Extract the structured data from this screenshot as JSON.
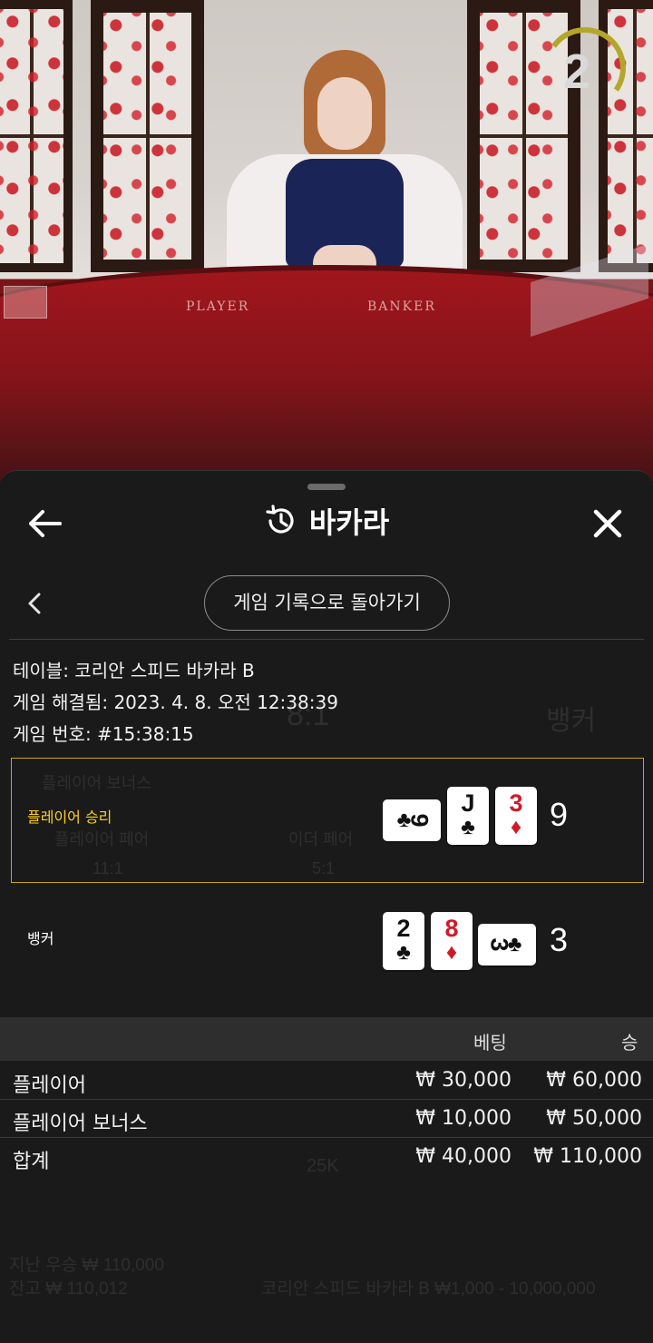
{
  "video": {
    "timer_value": "2",
    "felt_left": "PLAYER",
    "felt_right": "BANKER"
  },
  "header": {
    "title": "바카라"
  },
  "subnav": {
    "back_to_history_label": "게임 기록으로 돌아가기"
  },
  "info": {
    "table": "테이블: 코리안 스피드 바카라 B",
    "resolved": "게임 해결됨: 2023. 4. 8. 오전 12:38:39",
    "game_number": "게임 번호: #15:38:15"
  },
  "result": {
    "player": {
      "label": "플레이어 승리",
      "score": "9",
      "cards": [
        {
          "rank": "9",
          "suit": "♣",
          "color": "black",
          "sideways": true
        },
        {
          "rank": "J",
          "suit": "♣",
          "color": "black",
          "sideways": false
        },
        {
          "rank": "3",
          "suit": "♦",
          "color": "red",
          "sideways": false
        }
      ]
    },
    "banker": {
      "label": "뱅커",
      "score": "3",
      "cards": [
        {
          "rank": "2",
          "suit": "♣",
          "color": "black",
          "sideways": false
        },
        {
          "rank": "8",
          "suit": "♦",
          "color": "red",
          "sideways": false
        },
        {
          "rank": "3",
          "suit": "♣",
          "color": "black",
          "sideways": true
        }
      ]
    }
  },
  "bets": {
    "header_bet": "베팅",
    "header_win": "승",
    "rows": [
      {
        "name": "플레이어",
        "bet": "₩ 30,000",
        "win": "₩ 60,000"
      },
      {
        "name": "플레이어 보너스",
        "bet": "₩ 10,000",
        "win": "₩ 50,000"
      },
      {
        "name": "합계",
        "bet": "₩ 40,000",
        "win": "₩ 110,000"
      }
    ]
  },
  "background_ghost": {
    "ratio": "8:1",
    "banker": "뱅커",
    "player_bonus": "플레이어 보너스",
    "player_pair": "플레이어 페어",
    "either_pair": "이더 페어",
    "payout_11": "11:1",
    "payout_5": "5:1",
    "balance": "잔고 ₩ 110,012",
    "last_win": "지난 우승 ₩ 110,000",
    "table_limits": "코리안 스피드 바카라 B ₩1,000 - 10,000,000",
    "chip": "25K"
  }
}
